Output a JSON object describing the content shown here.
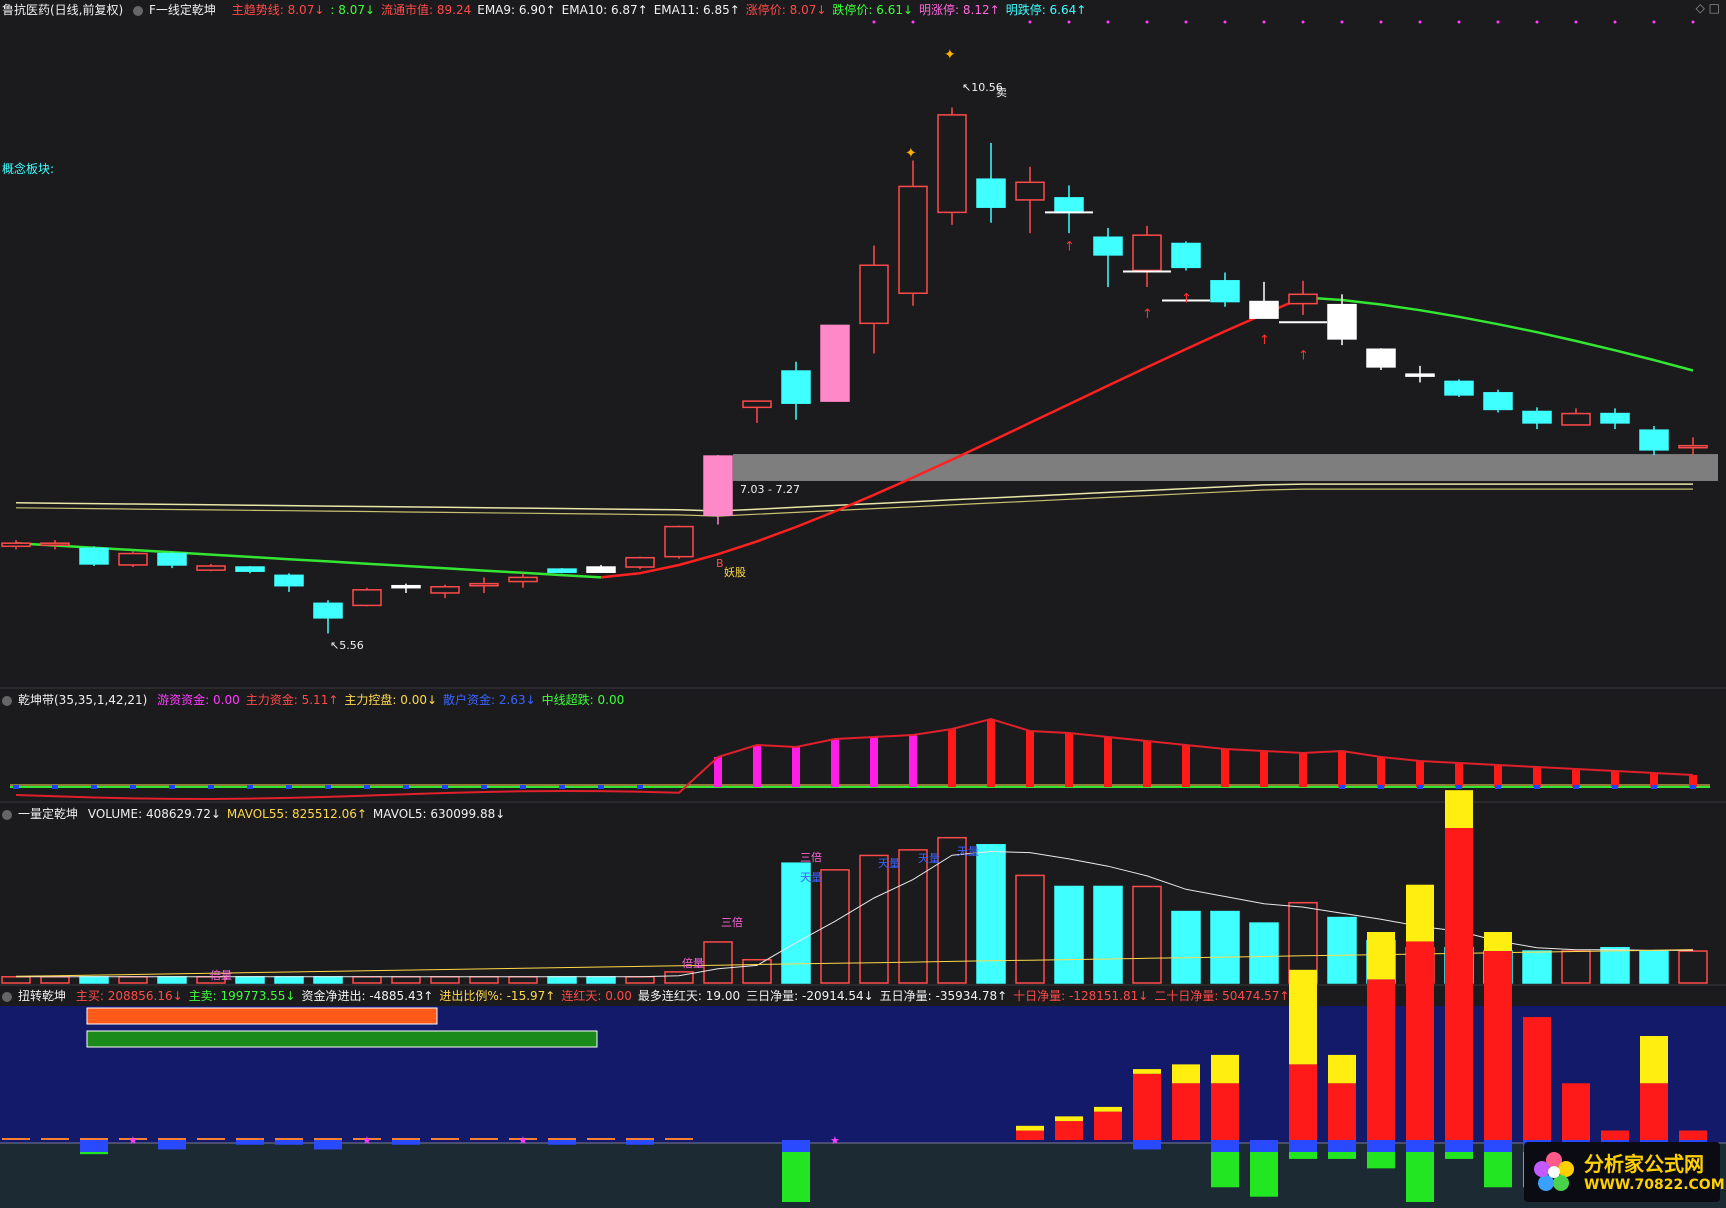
{
  "panels": {
    "main": {
      "stock_name": "鲁抗医药(日线,前复权)",
      "formula_name": "F一线定乾坤",
      "items": [
        {
          "label": "主趋势线:",
          "value": "8.07",
          "arrow": "↓",
          "color": "#ff4a4a"
        },
        {
          "label": ":",
          "value": "8.07",
          "arrow": "↓",
          "color": "#3cff3c"
        },
        {
          "label": "流通市值:",
          "value": "89.24",
          "arrow": "",
          "color": "#ff4a4a"
        },
        {
          "label": "EMA9:",
          "value": "6.90",
          "arrow": "↑",
          "color": "#f0f0f0"
        },
        {
          "label": "EMA10:",
          "value": "6.87",
          "arrow": "↑",
          "color": "#f0f0f0"
        },
        {
          "label": "EMA11:",
          "value": "6.85",
          "arrow": "↑",
          "color": "#f0f0f0"
        },
        {
          "label": "涨停价:",
          "value": "8.07",
          "arrow": "↓",
          "color": "#ff4a4a"
        },
        {
          "label": "跌停价:",
          "value": "6.61",
          "arrow": "↓",
          "color": "#3cff3c"
        },
        {
          "label": "明涨停:",
          "value": "8.12",
          "arrow": "↑",
          "color": "#ff66dd"
        },
        {
          "label": "明跌停:",
          "value": "6.64",
          "arrow": "↑",
          "color": "#3fffff"
        }
      ],
      "side_label": "概念板块:",
      "high_label": "10.56",
      "high_sell": "卖",
      "low_label": "5.56",
      "range_label": "7.03 - 7.27",
      "buy_mark": "B",
      "demon_label": "妖股"
    },
    "qiankun": {
      "title": "乾坤带(35,35,1,42,21)",
      "items": [
        {
          "label": "游资资金:",
          "value": "0.00",
          "arrow": "",
          "color": "#ff3cff"
        },
        {
          "label": "主力资金:",
          "value": "5.11",
          "arrow": "↑",
          "color": "#ff4a4a"
        },
        {
          "label": "主力控盘:",
          "value": "0.00",
          "arrow": "↓",
          "color": "#ffd84a"
        },
        {
          "label": "散户资金:",
          "value": "2.63",
          "arrow": "↓",
          "color": "#3a64ff"
        },
        {
          "label": "中线超跌:",
          "value": "0.00",
          "arrow": "",
          "color": "#3cff3c"
        }
      ]
    },
    "volume": {
      "title": "一量定乾坤",
      "items": [
        {
          "label": "VOLUME:",
          "value": "408629.72",
          "arrow": "↓",
          "color": "#f0f0f0"
        },
        {
          "label": "MAVOL55:",
          "value": "825512.06",
          "arrow": "↑",
          "color": "#ffd84a"
        },
        {
          "label": "MAVOL5:",
          "value": "630099.88",
          "arrow": "↓",
          "color": "#f0f0f0"
        }
      ],
      "tags": [
        "倍量",
        "倍量",
        "三倍",
        "三倍",
        "天量",
        "天量",
        "天量",
        "天量"
      ]
    },
    "flow": {
      "title": "扭转乾坤",
      "items": [
        {
          "label": "主买:",
          "value": "208856.16",
          "arrow": "↓",
          "color": "#ff4a4a"
        },
        {
          "label": "主卖:",
          "value": "199773.55",
          "arrow": "↓",
          "color": "#3cff3c"
        },
        {
          "label": "资金净进出:",
          "value": "-4885.43",
          "arrow": "↑",
          "color": "#f0f0f0"
        },
        {
          "label": "进出比例%:",
          "value": "-15.97",
          "arrow": "↑",
          "color": "#ffd84a"
        },
        {
          "label": "连红天:",
          "value": "0.00",
          "arrow": "",
          "color": "#ff4a4a"
        },
        {
          "label": "最多连红天:",
          "value": "19.00",
          "arrow": "",
          "color": "#f0f0f0"
        },
        {
          "label": "三日净量:",
          "value": "-20914.54",
          "arrow": "↓",
          "color": "#f0f0f0"
        },
        {
          "label": "五日净量:",
          "value": "-35934.78",
          "arrow": "↑",
          "color": "#f0f0f0"
        },
        {
          "label": "十日净量:",
          "value": "-128151.81",
          "arrow": "↓",
          "color": "#ff4a4a"
        },
        {
          "label": "二十日净量:",
          "value": "50474.57",
          "arrow": "↑",
          "color": "#ff4a4a"
        }
      ]
    }
  },
  "logo": {
    "brand": "分析家公式网",
    "url": "WWW.70822.COM"
  },
  "colors": {
    "bg": "#1b1b1d",
    "up": "#ff4a4a",
    "down": "#3fffff",
    "pink": "#ff88c8",
    "white": "#ffffff"
  },
  "chart_data": {
    "type": "candlestick",
    "title": "",
    "y_range_main": [
      5.4,
      10.8
    ],
    "candles": [
      {
        "o": 6.4,
        "c": 6.43,
        "h": 6.46,
        "l": 6.37,
        "k": "u"
      },
      {
        "o": 6.43,
        "c": 6.42,
        "h": 6.46,
        "l": 6.37,
        "k": "u"
      },
      {
        "o": 6.38,
        "c": 6.23,
        "h": 6.4,
        "l": 6.21,
        "k": "d"
      },
      {
        "o": 6.22,
        "c": 6.33,
        "h": 6.35,
        "l": 6.2,
        "k": "u"
      },
      {
        "o": 6.33,
        "c": 6.22,
        "h": 6.34,
        "l": 6.19,
        "k": "d"
      },
      {
        "o": 6.17,
        "c": 6.21,
        "h": 6.23,
        "l": 6.16,
        "k": "u"
      },
      {
        "o": 6.2,
        "c": 6.16,
        "h": 6.21,
        "l": 6.14,
        "k": "d"
      },
      {
        "o": 6.12,
        "c": 6.02,
        "h": 6.14,
        "l": 5.96,
        "k": "d"
      },
      {
        "o": 5.85,
        "c": 5.71,
        "h": 5.88,
        "l": 5.56,
        "k": "d"
      },
      {
        "o": 5.83,
        "c": 5.98,
        "h": 6.0,
        "l": 5.82,
        "k": "u"
      },
      {
        "o": 6.02,
        "c": 6.02,
        "h": 6.04,
        "l": 5.95,
        "k": "w"
      },
      {
        "o": 5.95,
        "c": 6.01,
        "h": 6.03,
        "l": 5.9,
        "k": "u"
      },
      {
        "o": 6.02,
        "c": 6.04,
        "h": 6.1,
        "l": 5.95,
        "k": "u"
      },
      {
        "o": 6.06,
        "c": 6.1,
        "h": 6.14,
        "l": 6.0,
        "k": "u"
      },
      {
        "o": 6.18,
        "c": 6.15,
        "h": 6.19,
        "l": 6.14,
        "k": "d"
      },
      {
        "o": 6.2,
        "c": 6.15,
        "h": 6.22,
        "l": 6.15,
        "k": "wh"
      },
      {
        "o": 6.2,
        "c": 6.29,
        "h": 6.3,
        "l": 6.18,
        "k": "u"
      },
      {
        "o": 6.3,
        "c": 6.59,
        "h": 6.6,
        "l": 6.28,
        "k": "u"
      },
      {
        "o": 6.7,
        "c": 7.27,
        "h": 7.28,
        "l": 6.61,
        "k": "p"
      },
      {
        "o": 7.74,
        "c": 7.8,
        "h": 7.8,
        "l": 7.59,
        "k": "u"
      },
      {
        "o": 8.09,
        "c": 7.78,
        "h": 8.18,
        "l": 7.62,
        "k": "d"
      },
      {
        "o": 7.8,
        "c": 8.53,
        "h": 8.53,
        "l": 7.8,
        "k": "p"
      },
      {
        "o": 8.55,
        "c": 9.11,
        "h": 9.3,
        "l": 8.26,
        "k": "u"
      },
      {
        "o": 8.84,
        "c": 9.87,
        "h": 10.12,
        "l": 8.72,
        "k": "u"
      },
      {
        "o": 9.62,
        "c": 10.56,
        "h": 10.63,
        "l": 9.5,
        "k": "u"
      },
      {
        "o": 9.94,
        "c": 9.67,
        "h": 10.29,
        "l": 9.52,
        "k": "d"
      },
      {
        "o": 9.74,
        "c": 9.91,
        "h": 10.06,
        "l": 9.42,
        "k": "u"
      },
      {
        "o": 9.62,
        "c": 9.76,
        "h": 9.88,
        "l": 9.42,
        "k": "d"
      },
      {
        "o": 9.38,
        "c": 9.21,
        "h": 9.47,
        "l": 8.9,
        "k": "d"
      },
      {
        "o": 9.06,
        "c": 9.4,
        "h": 9.49,
        "l": 8.9,
        "k": "u"
      },
      {
        "o": 9.32,
        "c": 9.09,
        "h": 9.34,
        "l": 9.06,
        "k": "d"
      },
      {
        "o": 8.96,
        "c": 8.76,
        "h": 9.04,
        "l": 8.71,
        "k": "d"
      },
      {
        "o": 8.76,
        "c": 8.6,
        "h": 8.95,
        "l": 8.6,
        "k": "wh"
      },
      {
        "o": 8.74,
        "c": 8.83,
        "h": 8.96,
        "l": 8.63,
        "k": "u"
      },
      {
        "o": 8.73,
        "c": 8.4,
        "h": 8.83,
        "l": 8.34,
        "k": "wh"
      },
      {
        "o": 8.3,
        "c": 8.13,
        "h": 8.31,
        "l": 8.1,
        "k": "wh"
      },
      {
        "o": 8.06,
        "c": 8.06,
        "h": 8.14,
        "l": 7.98,
        "k": "w"
      },
      {
        "o": 7.99,
        "c": 7.86,
        "h": 8.01,
        "l": 7.84,
        "k": "d"
      },
      {
        "o": 7.88,
        "c": 7.72,
        "h": 7.91,
        "l": 7.69,
        "k": "d"
      },
      {
        "o": 7.7,
        "c": 7.59,
        "h": 7.74,
        "l": 7.53,
        "k": "d"
      },
      {
        "o": 7.57,
        "c": 7.68,
        "h": 7.73,
        "l": 7.57,
        "k": "u"
      },
      {
        "o": 7.68,
        "c": 7.59,
        "h": 7.73,
        "l": 7.53,
        "k": "d"
      },
      {
        "o": 7.52,
        "c": 7.33,
        "h": 7.56,
        "l": 7.28,
        "k": "d"
      },
      {
        "o": 7.37,
        "c": 7.37,
        "h": 7.45,
        "l": 7.28,
        "k": "u"
      }
    ],
    "volume_y_range": [
      0,
      1000
    ],
    "volume": [
      28,
      28,
      28,
      28,
      28,
      28,
      28,
      28,
      28,
      28,
      28,
      28,
      28,
      28,
      28,
      28,
      28,
      50,
      185,
      105,
      540,
      510,
      575,
      600,
      655,
      623,
      485,
      435,
      435,
      435,
      322,
      322,
      270,
      362,
      295,
      190,
      159,
      159,
      144,
      144,
      144,
      159,
      144,
      144
    ],
    "flow_y_range": [
      -150,
      400
    ],
    "flow_red": [
      0,
      0,
      0,
      0,
      0,
      0,
      0,
      0,
      0,
      0,
      0,
      0,
      0,
      0,
      10,
      20,
      30,
      70,
      60,
      60,
      0,
      80,
      60,
      170,
      210,
      330,
      200,
      130,
      60,
      10,
      60,
      10
    ],
    "flow_yellow": [
      0,
      0,
      0,
      0,
      0,
      0,
      0,
      0,
      0,
      0,
      0,
      0,
      0,
      0,
      5,
      5,
      5,
      5,
      20,
      30,
      0,
      100,
      30,
      50,
      60,
      40,
      20,
      0,
      0,
      0,
      50,
      0
    ],
    "flow_neg": [
      0,
      0,
      -15,
      0,
      -10,
      0,
      -5,
      -5,
      -10,
      0,
      -5,
      0,
      0,
      0,
      -5,
      0,
      -5,
      0,
      0,
      0,
      -130,
      0,
      0,
      0,
      0,
      0,
      0,
      0,
      0,
      -10,
      0,
      -50,
      -60,
      -20,
      -20,
      -30,
      -70,
      -20,
      -50,
      -50,
      -10,
      -20,
      -40,
      -20
    ]
  }
}
